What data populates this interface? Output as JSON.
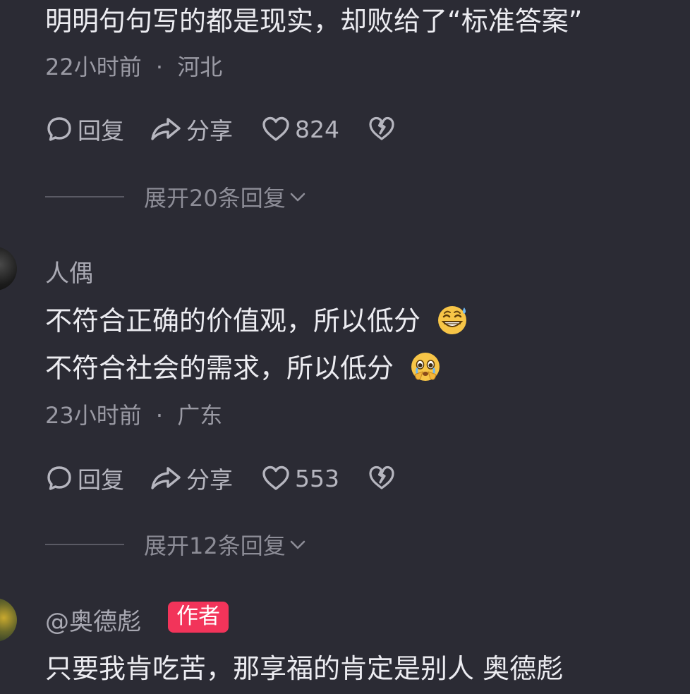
{
  "comments": [
    {
      "text_lines": [
        "明明句句写的都是现实，却败给了“标准答案”"
      ],
      "time": "22小时前",
      "location": "河北",
      "actions": {
        "reply": "回复",
        "share": "分享",
        "likes": "824"
      },
      "expand_label": "展开20条回复"
    },
    {
      "username": "人偶",
      "text_lines": [
        "不符合正确的价值观，所以低分",
        "不符合社会的需求，所以低分"
      ],
      "emoji_icons": [
        "grinning-sweat-emoji",
        "pleading-tears-emoji"
      ],
      "time": "23小时前",
      "location": "广东",
      "actions": {
        "reply": "回复",
        "share": "分享",
        "likes": "553"
      },
      "expand_label": "展开12条回复"
    },
    {
      "username": "@奥德彪",
      "badge": "作者",
      "text_lines": [
        "只要我肯吃苦，那享福的肯定是别人 奥德彪"
      ]
    }
  ],
  "meta_separator": "·",
  "colors": {
    "background": "#2b2b34",
    "badge": "#f2345a"
  }
}
